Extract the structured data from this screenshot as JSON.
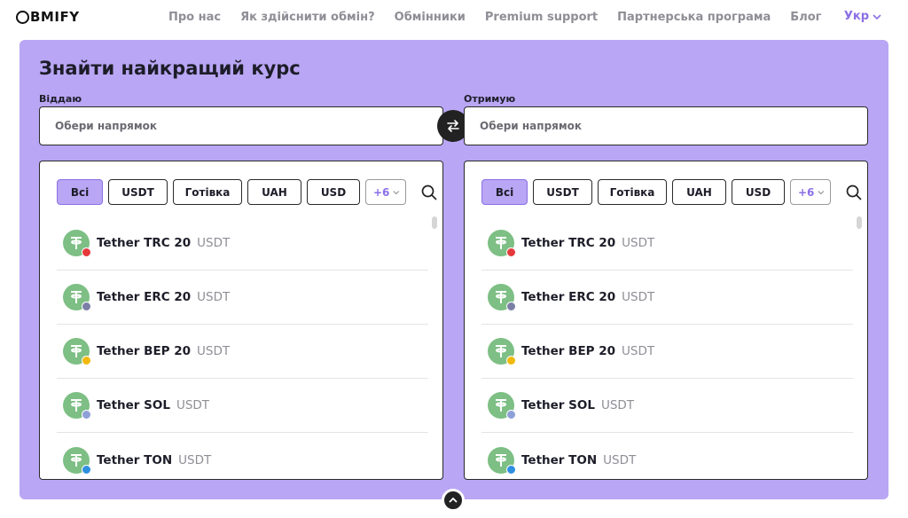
{
  "brand": {
    "logo_text": "BMIFY"
  },
  "nav": [
    {
      "label": "Про нас"
    },
    {
      "label": "Як здійснити обмін?"
    },
    {
      "label": "Обмінники"
    },
    {
      "label": "Premium support"
    },
    {
      "label": "Партнерська програма"
    },
    {
      "label": "Блог"
    }
  ],
  "language": {
    "label": "Укр"
  },
  "exchange": {
    "title": "Знайти найкращий курс",
    "give": {
      "label": "Віддаю",
      "placeholder": "Обери напрямок"
    },
    "get": {
      "label": "Отримую",
      "placeholder": "Обери напрямок"
    }
  },
  "filters": {
    "chips": [
      "Всі",
      "USDT",
      "Готівка",
      "UAH",
      "USD"
    ],
    "active": "Всі",
    "more_label": "+6"
  },
  "currencies": [
    {
      "name": "Tether TRC 20",
      "ticker": "USDT",
      "network_color": "#e5393b"
    },
    {
      "name": "Tether ERC 20",
      "ticker": "USDT",
      "network_color": "#7b7fa6"
    },
    {
      "name": "Tether BEP 20",
      "ticker": "USDT",
      "network_color": "#f0b90b"
    },
    {
      "name": "Tether SOL",
      "ticker": "USDT",
      "network_color": "#8fa0d8"
    },
    {
      "name": "Tether TON",
      "ticker": "USDT",
      "network_color": "#2f8fe0"
    }
  ],
  "colors": {
    "accent": "#b9a6f4",
    "accent_text": "#8b6fe6",
    "coin": "#7dbf84"
  }
}
